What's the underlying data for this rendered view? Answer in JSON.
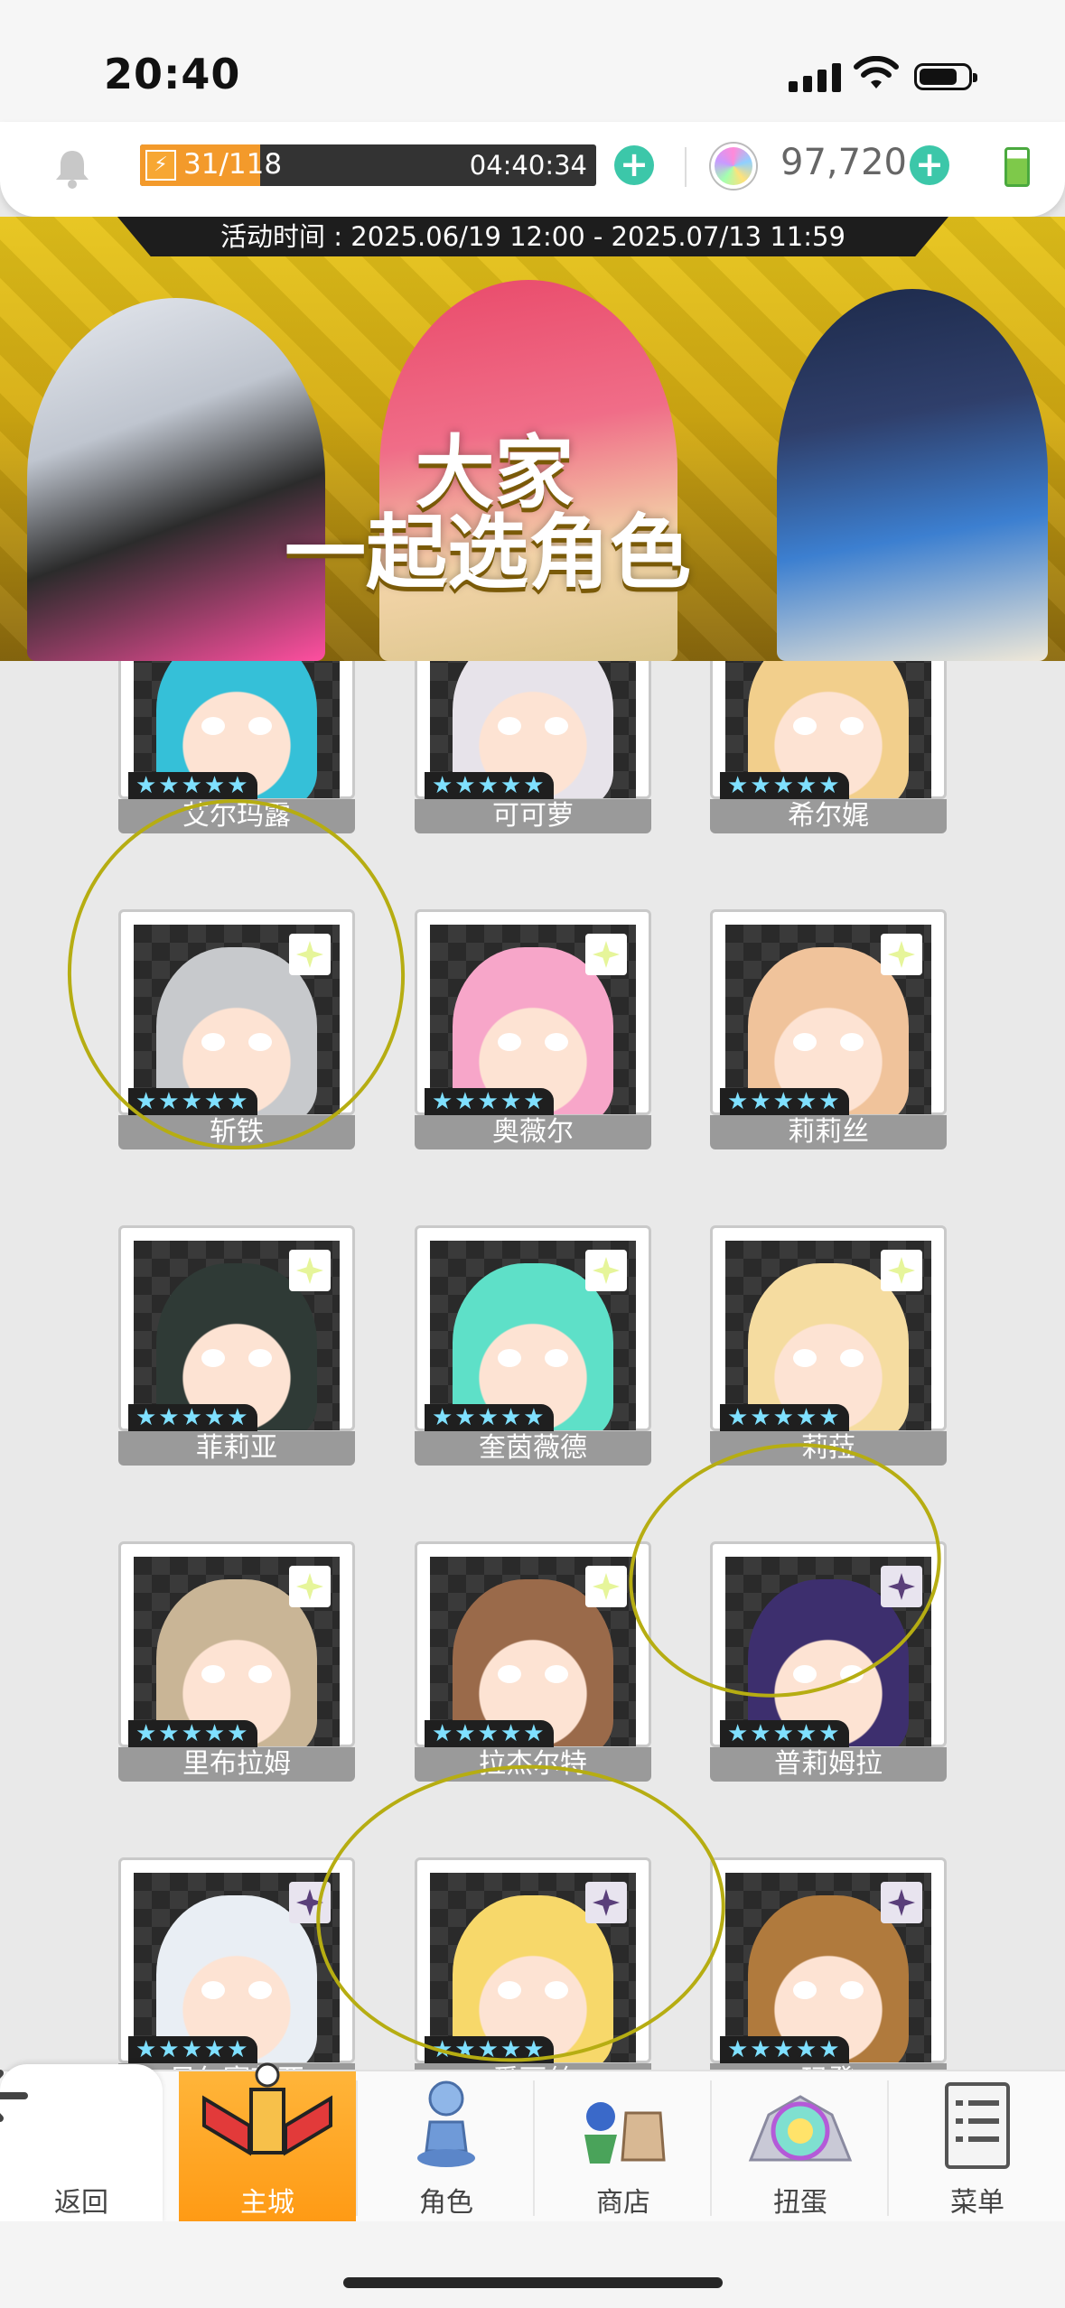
{
  "status_bar": {
    "time": "20:40"
  },
  "resources": {
    "energy_current": "31",
    "energy_max": "118",
    "energy_separator": "/",
    "energy_fraction": 0.263,
    "energy_timer": "04:40:34",
    "gems": "97,720"
  },
  "banner": {
    "event_time": "活动时间 : 2025.06/19 12:00 - 2025.07/13 11:59",
    "title_line1": "大家",
    "title_line2": "一起选角色"
  },
  "roster": {
    "characters": [
      {
        "name": "艾尔玛露",
        "stars": "★★★★★",
        "color": "#35c0d8",
        "corner": "none"
      },
      {
        "name": "可可萝",
        "stars": "★★★★★",
        "color": "#e7e3ea",
        "corner": "none"
      },
      {
        "name": "希尔娓",
        "stars": "★★★★★",
        "color": "#f2cf8c",
        "corner": "none"
      },
      {
        "name": "斩铁",
        "stars": "★★★★★",
        "color": "#c7c9cc",
        "corner": "light"
      },
      {
        "name": "奥薇尔",
        "stars": "★★★★★",
        "color": "#f7a6c9",
        "corner": "light"
      },
      {
        "name": "莉莉丝",
        "stars": "★★★★★",
        "color": "#f0c39b",
        "corner": "light"
      },
      {
        "name": "菲莉亚",
        "stars": "★★★★★",
        "color": "#2f3a36",
        "corner": "light"
      },
      {
        "name": "奎茵薇德",
        "stars": "★★★★★",
        "color": "#5ee0c8",
        "corner": "light"
      },
      {
        "name": "莉菈",
        "stars": "★★★★★",
        "color": "#f5dca0",
        "corner": "light"
      },
      {
        "name": "里布拉姆",
        "stars": "★★★★★",
        "color": "#c9b596",
        "corner": "light"
      },
      {
        "name": "拉杰尔特",
        "stars": "★★★★★",
        "color": "#9a6a4a",
        "corner": "light"
      },
      {
        "name": "普莉姆拉",
        "stars": "★★★★★",
        "color": "#3d2f6e",
        "corner": "dark"
      },
      {
        "name": "贝尔赛芙亚",
        "stars": "★★★★★",
        "color": "#e9eef4",
        "corner": "dark"
      },
      {
        "name": "爱丽丝",
        "stars": "★★★★★",
        "color": "#f7d86a",
        "corner": "dark"
      },
      {
        "name": "玛登",
        "stars": "★★★★★",
        "color": "#b07a3d",
        "corner": "dark"
      }
    ]
  },
  "nav": {
    "back": "返回",
    "home": "主城",
    "characters": "角色",
    "shop": "商店",
    "gacha": "扭蛋",
    "menu": "菜单"
  },
  "colors": {
    "accent_teal": "#3cc7a9",
    "energy_orange": "#f39a2b",
    "active_tab": "#ff9a14",
    "annotation_circle": "#b6ad12"
  }
}
